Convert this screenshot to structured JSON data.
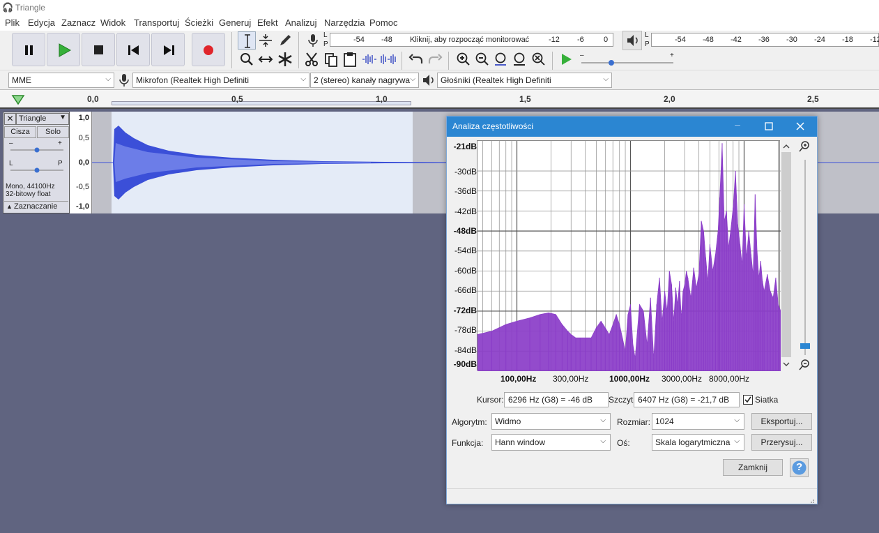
{
  "app": {
    "title": "Triangle"
  },
  "menu": [
    "Plik",
    "Edycja",
    "Zaznacz",
    "Widok",
    "Transportuj",
    "Ścieżki",
    "Generuj",
    "Efekt",
    "Analizuj",
    "Narzędzia",
    "Pomoc"
  ],
  "meters": {
    "record_ticks": [
      "-54",
      "-48",
      "-12",
      "-6",
      "0"
    ],
    "record_prompt": "Kliknij, aby rozpocząć monitorować",
    "play_ticks": [
      "-54",
      "-48",
      "-42",
      "-36",
      "-30",
      "-24",
      "-18",
      "-12"
    ],
    "lp_l": "L",
    "lp_p": "P"
  },
  "devices": {
    "host": "MME",
    "mic": "Mikrofon (Realtek High Definiti",
    "channels": "2 (stereo) kanały nagrywa",
    "speaker": "Głośniki (Realtek High Definiti"
  },
  "ruler": [
    "0,0",
    "0,5",
    "1,0",
    "1,5",
    "2,0",
    "2,5"
  ],
  "track": {
    "name": "Triangle",
    "mute": "Cisza",
    "solo": "Solo",
    "gain_minus": "–",
    "gain_plus": "+",
    "pan_l": "L",
    "pan_p": "P",
    "info_rate": "Mono, 44100Hz",
    "info_format": "32-bitowy float",
    "select_label": "Zaznaczanie",
    "scale": [
      "1,0",
      "0,5",
      "0,0",
      "-0,5",
      "-1,0"
    ]
  },
  "dialog": {
    "title": "Analiza częstotliwości",
    "cursor_label": "Kursor:",
    "cursor_value": "6296 Hz (G8) = -46 dB",
    "peak_label": "Szczyt:",
    "peak_value": "6407 Hz (G8) = -21,7 dB",
    "grid_label": "Siatka",
    "grid_checked": true,
    "algorithm_label": "Algorytm:",
    "algorithm_value": "Widmo",
    "size_label": "Rozmiar:",
    "size_value": "1024",
    "export_button": "Eksportuj...",
    "function_label": "Funkcja:",
    "function_value": "Hann window",
    "axis_label": "Oś:",
    "axis_value": "Skala logarytmiczna",
    "replot_button": "Przerysuj...",
    "close_button": "Zamknij",
    "help_button": "?"
  },
  "chart_data": {
    "type": "area",
    "x_scale": "log",
    "y_ticks": [
      "-21dB",
      "-30dB",
      "-36dB",
      "-42dB",
      "-48dB",
      "-54dB",
      "-60dB",
      "-66dB",
      "-72dB",
      "-78dB",
      "-84dB",
      "-90dB"
    ],
    "x_ticks": [
      "100,00Hz",
      "300,00Hz",
      "1000,00Hz",
      "3000,00Hz",
      "8000,00Hz"
    ],
    "xlim": [
      45,
      21000
    ],
    "ylim": [
      -90,
      -21
    ],
    "grid": true,
    "color": "#8a3cc8",
    "series": [
      {
        "x": [
          45,
          60,
          80,
          100,
          130,
          160,
          190,
          220,
          250,
          280,
          300,
          330,
          360,
          400,
          450,
          500,
          550,
          600,
          650,
          700,
          750,
          800,
          850,
          900,
          950,
          1000,
          1050,
          1100,
          1200,
          1300,
          1400,
          1500,
          1600,
          1700,
          1800,
          1900,
          2000,
          2100,
          2200,
          2300,
          2400,
          2500,
          2600,
          2700,
          2800,
          2900,
          3000,
          3100,
          3200,
          3400,
          3600,
          3800,
          4000,
          4200,
          4400,
          4600,
          4800,
          5000,
          5300,
          5600,
          5900,
          6100,
          6407,
          6700,
          7000,
          7300,
          7600,
          8000,
          8400,
          8800,
          9200,
          9600,
          10000,
          10500,
          11000,
          11500,
          12000,
          12500,
          13000,
          13500,
          14000,
          14500,
          15000,
          16000,
          17000,
          18000,
          19000,
          20000,
          21000
        ],
        "y": [
          -79,
          -78,
          -76,
          -75,
          -74,
          -73,
          -72.5,
          -73,
          -76,
          -78,
          -79,
          -80,
          -80,
          -80,
          -80,
          -77,
          -75,
          -77,
          -79,
          -76,
          -73,
          -76,
          -80,
          -84,
          -73,
          -70,
          -82,
          -86,
          -70,
          -72,
          -82,
          -68,
          -86,
          -70,
          -62,
          -75,
          -66,
          -72,
          -60,
          -64,
          -75,
          -65,
          -70,
          -63,
          -74,
          -66,
          -64,
          -60,
          -62,
          -68,
          -59,
          -65,
          -61,
          -45,
          -48,
          -56,
          -63,
          -52,
          -60,
          -55,
          -48,
          -38,
          -21.7,
          -45,
          -42,
          -53,
          -48,
          -41,
          -30,
          -46,
          -52,
          -58,
          -40,
          -56,
          -48,
          -55,
          -61,
          -37,
          -54,
          -62,
          -57,
          -63,
          -66,
          -61,
          -66,
          -68,
          -62,
          -70,
          -72
        ]
      }
    ]
  }
}
